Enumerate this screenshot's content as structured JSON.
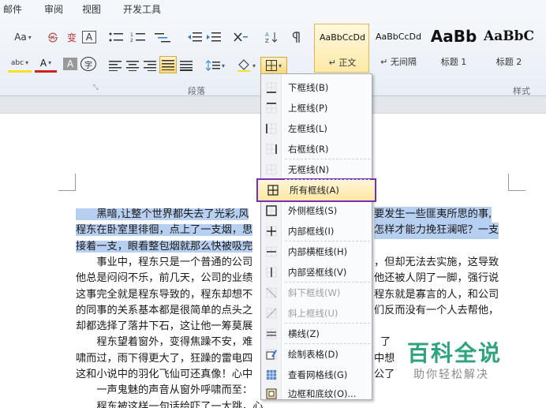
{
  "tabs": [
    "邮件",
    "审阅",
    "视图",
    "开发工具"
  ],
  "ribbon": {
    "font_row1": [
      "Aa",
      "变",
      "A"
    ],
    "font_row2": [
      "abc",
      "A",
      "A",
      "字"
    ],
    "paragraph_group_label": "段落",
    "styles_group_label": "样式"
  },
  "styles_gallery": [
    {
      "sample": "AaBbCcDd",
      "name": "正文",
      "selected": true
    },
    {
      "sample": "AaBbCcDd",
      "name": "无间隔",
      "selected": false
    },
    {
      "sample": "AaBb",
      "name": "标题 1",
      "selected": false
    },
    {
      "sample": "AaBbC",
      "name": "标题 2",
      "selected": false
    }
  ],
  "border_menu": {
    "items": [
      {
        "label": "下框线(B)",
        "icon": "bottom-border-icon",
        "disabled": false
      },
      {
        "label": "上框线(P)",
        "icon": "top-border-icon",
        "disabled": false
      },
      {
        "label": "左框线(L)",
        "icon": "left-border-icon",
        "disabled": false
      },
      {
        "label": "右框线(R)",
        "icon": "right-border-icon",
        "disabled": false
      },
      {
        "label": "无框线(N)",
        "icon": "no-border-icon",
        "disabled": false
      },
      {
        "label": "所有框线(A)",
        "icon": "all-borders-icon",
        "disabled": false,
        "highlighted": true
      },
      {
        "label": "外侧框线(S)",
        "icon": "outside-borders-icon",
        "disabled": false
      },
      {
        "label": "内部框线(I)",
        "icon": "inside-borders-icon",
        "disabled": false
      },
      {
        "label": "内部横框线(H)",
        "icon": "inside-horizontal-border-icon",
        "disabled": false
      },
      {
        "label": "内部竖框线(V)",
        "icon": "inside-vertical-border-icon",
        "disabled": false
      },
      {
        "label": "斜下框线(W)",
        "icon": "diagonal-down-border-icon",
        "disabled": true
      },
      {
        "label": "斜上框线(U)",
        "icon": "diagonal-up-border-icon",
        "disabled": true
      },
      {
        "label": "横线(Z)",
        "icon": "horizontal-line-icon",
        "disabled": false
      },
      {
        "label": "绘制表格(D)",
        "icon": "draw-table-icon",
        "disabled": false
      },
      {
        "label": "查看网格线(G)",
        "icon": "view-gridlines-icon",
        "disabled": false
      },
      {
        "label": "边框和底纹(O)...",
        "icon": "borders-shading-icon",
        "disabled": false
      }
    ]
  },
  "document": {
    "lines": [
      {
        "left": "　　黑暗,让整个世界都失去了光彩,风",
        "right": "要发生一些匪夷所思的事,",
        "highlight": true
      },
      {
        "left": "程东在卧室里徘徊，点上了一支烟，思",
        "right": "怎样才能力挽狂澜呢？一支",
        "highlight": true
      },
      {
        "left": "接着一支，眼看整包烟就那么快被吸完",
        "right": "",
        "highlight": true
      },
      {
        "left": "　　事业中，程东只是一个普通的公司",
        "right": "，但却无法去实施，这导致",
        "highlight": false
      },
      {
        "left": "他总是闷闷不乐，前几天，公司的业绩",
        "right": "他还被人阴了一脚，强行说",
        "highlight": false
      },
      {
        "left": "这事完全就是程东导致的，程东却想不",
        "right": "程东就是寡言的人，和公司",
        "highlight": false
      },
      {
        "left": "的同事的关系基本都是很简单的点头之",
        "right": "们反而没有一个人去帮他，",
        "highlight": false
      },
      {
        "left": "却都选择了落井下石，这让他一筹莫展",
        "right": "",
        "highlight": false
      },
      {
        "left": "　　程东望着窗外，变得焦躁不安，难",
        "right": "了",
        "highlight": false
      },
      {
        "left": "啸而过，雨下得更大了，狂躁的雷电四",
        "right": "中想",
        "highlight": false
      },
      {
        "left": "这和小说中的羽化飞仙可还真像！心中",
        "right": "公了",
        "highlight": false
      },
      {
        "left": "　　一声鬼魅的声音从窗外呼啸而至：",
        "right": "",
        "highlight": false
      },
      {
        "left": "　　程东被这样一句话给吓了一大跳，心",
        "right": "",
        "highlight": false
      }
    ]
  },
  "watermark": {
    "title": "百科全说",
    "subtitle": "助你轻松解决"
  }
}
